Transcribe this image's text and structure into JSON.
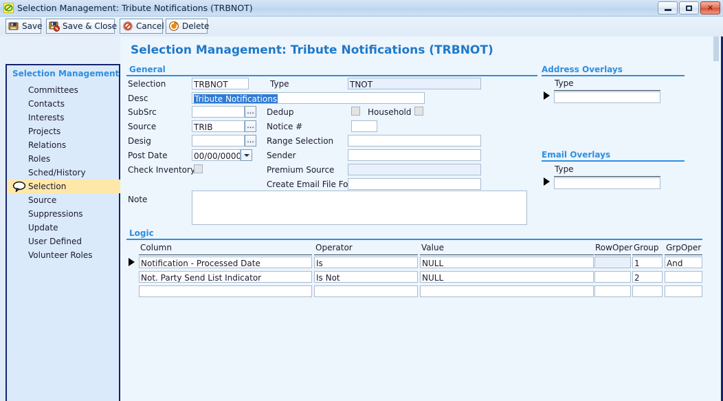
{
  "window": {
    "title": "Selection Management: Tribute Notifications (TRBNOT)",
    "icon": "app-logo-icon",
    "minimize_label": "",
    "maximize_label": "",
    "close_label": "✕"
  },
  "toolbar": {
    "buttons": [
      {
        "label": "Save",
        "icon": "save-icon"
      },
      {
        "label": "Save & Close",
        "icon": "save-close-icon"
      },
      {
        "label": "Cancel",
        "icon": "cancel-icon"
      },
      {
        "label": "Delete",
        "icon": "delete-icon"
      }
    ]
  },
  "sidebar": {
    "title": "Selection Management",
    "items": [
      {
        "label": "Committees",
        "active": false
      },
      {
        "label": "Contacts",
        "active": false
      },
      {
        "label": "Interests",
        "active": false
      },
      {
        "label": "Projects",
        "active": false
      },
      {
        "label": "Relations",
        "active": false
      },
      {
        "label": "Roles",
        "active": false
      },
      {
        "label": "Sched/History",
        "active": false
      },
      {
        "label": "Selection",
        "active": true
      },
      {
        "label": "Source",
        "active": false
      },
      {
        "label": "Suppressions",
        "active": false
      },
      {
        "label": "Update",
        "active": false
      },
      {
        "label": "User Defined",
        "active": false
      },
      {
        "label": "Volunteer Roles",
        "active": false
      }
    ]
  },
  "page": {
    "title": "Selection Management: Tribute Notifications (TRBNOT)"
  },
  "general": {
    "heading": "General",
    "selection_label": "Selection",
    "selection_value": "TRBNOT",
    "type_label": "Type",
    "type_value": "TNOT",
    "desc_label": "Desc",
    "desc_value": "Tribute Notifications",
    "subsrc_label": "SubSrc",
    "subsrc_value": "",
    "dedup_label": "Dedup",
    "household_label": "Household",
    "source_label": "Source",
    "source_value": "TRIB",
    "notice_label": "Notice #",
    "notice_value": "",
    "desig_label": "Desig",
    "desig_value": "",
    "range_selection_label": "Range Selection",
    "range_selection_value": "",
    "post_date_label": "Post Date",
    "post_date_value": "00/00/0000",
    "sender_label": "Sender",
    "sender_value": "",
    "check_inventory_label": "Check Inventory",
    "premium_source_label": "Premium Source",
    "premium_source_value": "",
    "create_email_file_label": "Create Email File For",
    "create_email_file_value": "",
    "note_label": "Note",
    "note_value": "",
    "ellipsis_label": "..."
  },
  "address_overlays": {
    "heading": "Address Overlays",
    "type_label": "Type",
    "type_value": ""
  },
  "email_overlays": {
    "heading": "Email Overlays",
    "type_label": "Type",
    "type_value": ""
  },
  "logic": {
    "heading": "Logic",
    "columns": [
      "Column",
      "Operator",
      "Value",
      "RowOper",
      "Group",
      "GrpOper"
    ],
    "rows": [
      {
        "column": "Notification - Processed Date",
        "operator": "Is",
        "value": "NULL",
        "rowoper": "",
        "rowoper_disabled": true,
        "group": "1",
        "grpoper": "And",
        "current": true
      },
      {
        "column": "Not. Party Send List Indicator",
        "operator": "Is Not",
        "value": "NULL",
        "rowoper": "",
        "rowoper_disabled": false,
        "group": "2",
        "grpoper": "",
        "current": false
      },
      {
        "column": "",
        "operator": "",
        "value": "",
        "rowoper": "",
        "rowoper_disabled": false,
        "group": "",
        "grpoper": "",
        "current": false
      }
    ]
  },
  "colors": {
    "accent_blue": "#2e8fdd",
    "title_blue": "#2079c9",
    "sidebar_bg": "#dbeafb",
    "sidebar_border": "#14246b",
    "active_row": "#ffe7a8",
    "panel_bg": "#edf5fd",
    "selection_highlight": "#2f7ad4"
  }
}
